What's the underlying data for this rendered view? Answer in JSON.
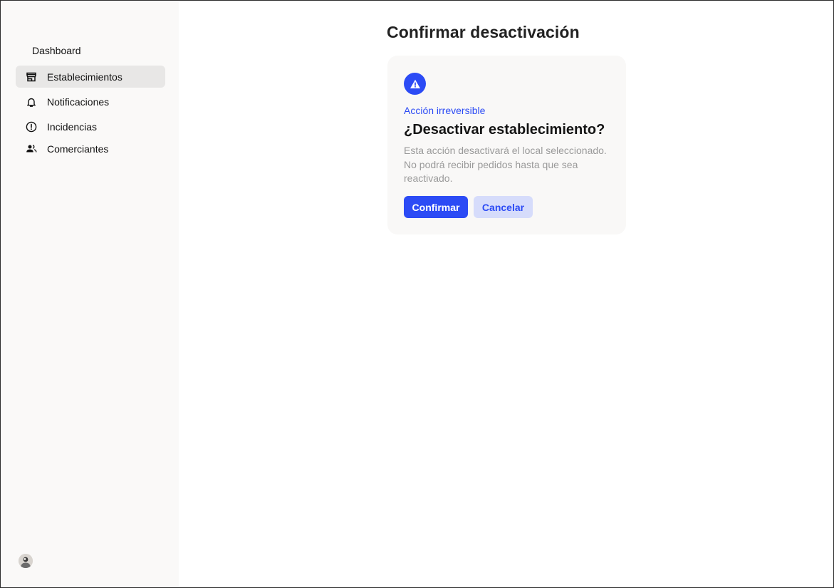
{
  "sidebar": {
    "items": [
      {
        "label": "Dashboard",
        "icon": "none",
        "active": false
      },
      {
        "label": "Establecimientos",
        "icon": "store-icon",
        "active": true
      },
      {
        "label": "Notificaciones",
        "icon": "bell-icon",
        "active": false
      },
      {
        "label": "Incidencias",
        "icon": "alert-circle-icon",
        "active": false
      },
      {
        "label": "Comerciantes",
        "icon": "users-icon",
        "active": false
      }
    ],
    "avatar_icon": "user-avatar"
  },
  "main": {
    "title": "Confirmar desactivación"
  },
  "dialog": {
    "icon": "warning-triangle-icon",
    "eyebrow": "Acción irreversible",
    "title": "¿Desactivar establecimiento?",
    "description": "Esta acción desactivará el local seleccionado. No podrá recibir pedidos hasta que sea reactivado.",
    "confirm_label": "Confirmar",
    "cancel_label": "Cancelar"
  },
  "colors": {
    "accent": "#2c4bf5",
    "accent_soft": "#d6dcfb",
    "sidebar_bg": "#faf9f8",
    "active_item_bg": "#e8e7e6",
    "card_bg": "#f9f8f7"
  }
}
